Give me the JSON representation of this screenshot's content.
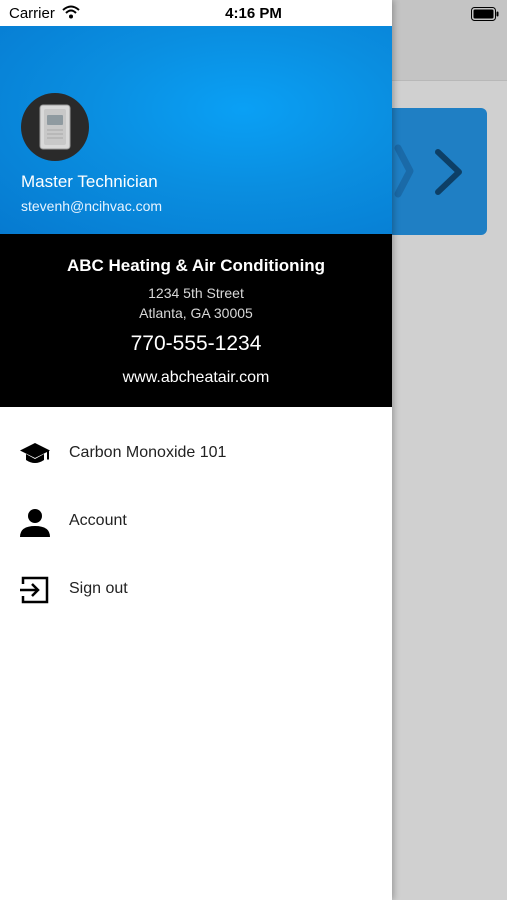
{
  "status_bar": {
    "carrier": "Carrier",
    "time": "4:16 PM"
  },
  "profile": {
    "role": "Master Technician",
    "email": "stevenh@ncihvac.com"
  },
  "company": {
    "name": "ABC Heating & Air Conditioning",
    "address_line1": "1234 5th Street",
    "address_line2": "Atlanta, GA 30005",
    "phone": "770-555-1234",
    "website": "www.abcheatair.com"
  },
  "menu": {
    "items": [
      {
        "label": "Carbon Monoxide 101",
        "icon": "graduation-cap-icon"
      },
      {
        "label": "Account",
        "icon": "person-icon"
      },
      {
        "label": "Sign out",
        "icon": "sign-out-icon"
      }
    ]
  },
  "colors": {
    "header_blue": "#0a8ee0",
    "company_bg": "#000000",
    "background_card": "#1f7fc4"
  }
}
